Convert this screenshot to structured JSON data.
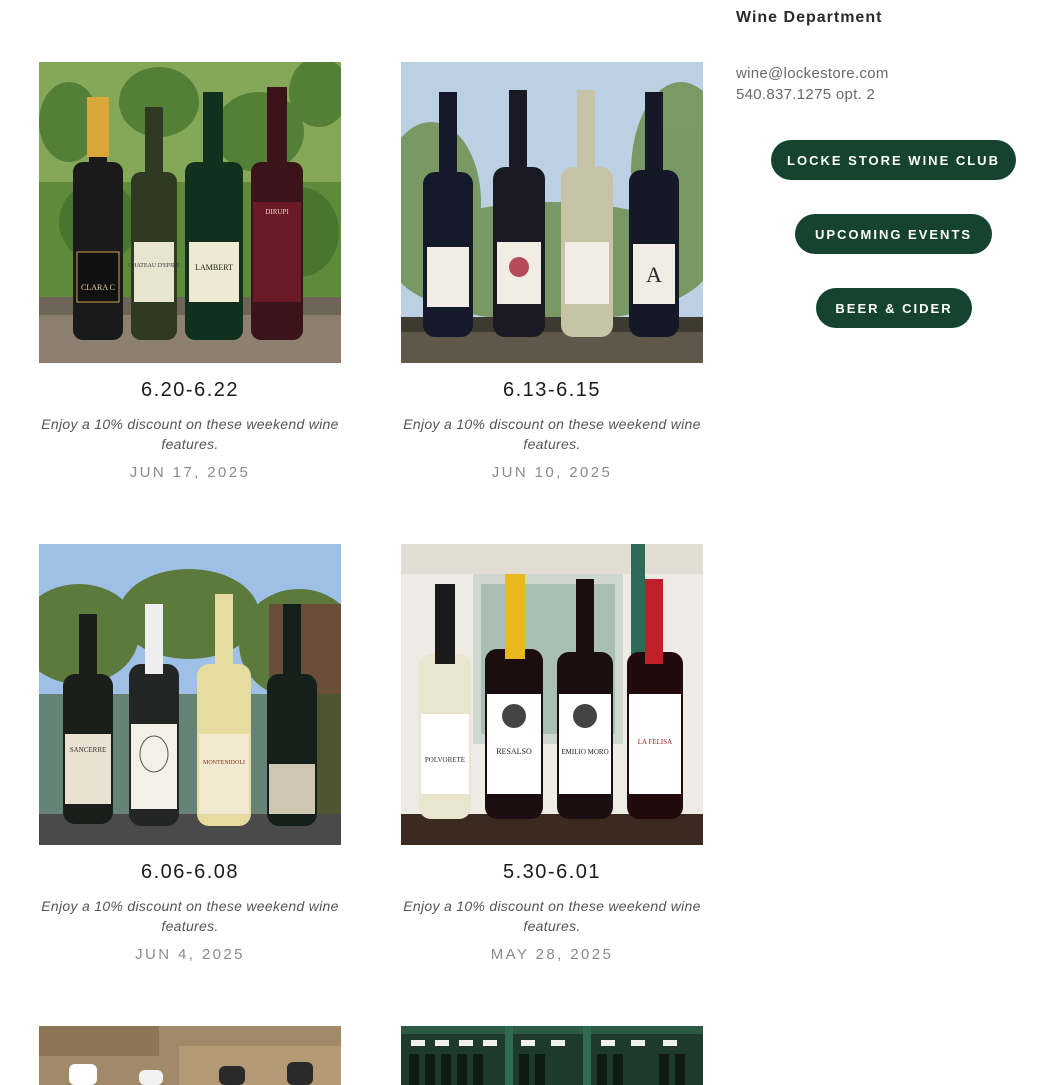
{
  "sidebar": {
    "department": "Wine Department",
    "email": "wine@lockestore.com",
    "phone": "540.837.1275 opt. 2",
    "buttons": {
      "wine_club": "LOCKE STORE WINE CLUB",
      "events": "UPCOMING EVENTS",
      "beer_cider": "BEER & CIDER"
    }
  },
  "posts": [
    {
      "title": "6.20-6.22",
      "excerpt": "Enjoy a 10% discount on these weekend wine features.",
      "date": "JUN 17, 2025",
      "bottle_labels": [
        "CLARA C",
        "CHATEAU D'EPIRE",
        "LAMBERT",
        "DIRUPI"
      ]
    },
    {
      "title": "6.13-6.15",
      "excerpt": "Enjoy a 10% discount on these weekend wine features.",
      "date": "JUN 10, 2025",
      "bottle_labels": [
        "",
        "",
        "",
        ""
      ]
    },
    {
      "title": "6.06-6.08",
      "excerpt": "Enjoy a 10% discount on these weekend wine features.",
      "date": "JUN 4, 2025",
      "bottle_labels": [
        "SANCERRE",
        "",
        "MONTENIDOLI",
        ""
      ]
    },
    {
      "title": "5.30-6.01",
      "excerpt": "Enjoy a 10% discount on these weekend wine features.",
      "date": "MAY 28, 2025",
      "bottle_labels": [
        "POLVORETE",
        "RESALSO",
        "EMILIO MORO",
        "LA FELISA"
      ]
    }
  ],
  "colors": {
    "button_bg": "#16432f",
    "date_text": "#8c8c8c"
  }
}
